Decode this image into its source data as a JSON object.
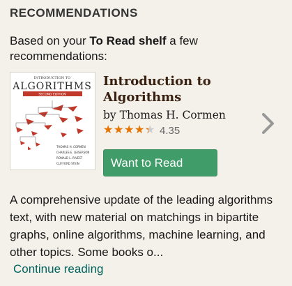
{
  "section_title": "RECOMMENDATIONS",
  "intro": {
    "prefix": "Based on your ",
    "shelf_name": "To Read shelf",
    "suffix": " a few recommendations:"
  },
  "book": {
    "title": "Introduction to Algorithms",
    "author_prefix": "by ",
    "author": "Thomas H. Cormen",
    "rating": 4.35,
    "rating_text": "4.35",
    "stars_max": 5,
    "star_color": "#e87400",
    "cover": {
      "top_text": "INTRODUCTION TO",
      "main_text": "ALGORITHMS",
      "edition_text": "SECOND EDITION",
      "authors": [
        "THOMAS H. CORMEN",
        "CHARLES E. LEISERSON",
        "RONALD L. RIVEST",
        "CLIFFORD STEIN"
      ],
      "accent_color": "#c0392b"
    }
  },
  "want_button": {
    "label": "Want to Read",
    "color": "#409d69"
  },
  "next_icon": "chevron-right-icon",
  "description": "A comprehensive update of the leading algorithms text, with new material on matchings in bipartite graphs, online algorithms, machine learning, and other topics. Some books o...",
  "continue_link": "Continue reading"
}
